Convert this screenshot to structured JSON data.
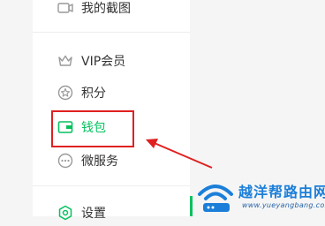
{
  "menu": {
    "items": [
      {
        "label": "我的截图",
        "icon": "screenshot-icon"
      },
      {
        "label": "VIP会员",
        "icon": "crown-icon"
      },
      {
        "label": "积分",
        "icon": "star-circle-icon"
      },
      {
        "label": "钱包",
        "icon": "wallet-icon",
        "active": true
      },
      {
        "label": "微服务",
        "icon": "more-dots-icon"
      },
      {
        "label": "设置",
        "icon": "settings-icon"
      }
    ]
  },
  "watermark": {
    "title": "越洋帮路由网",
    "url": "www.yueyangbang.com"
  },
  "colors": {
    "accent": "#07c160",
    "highlight": "#e02020",
    "watermark": "#1b7fd9"
  }
}
